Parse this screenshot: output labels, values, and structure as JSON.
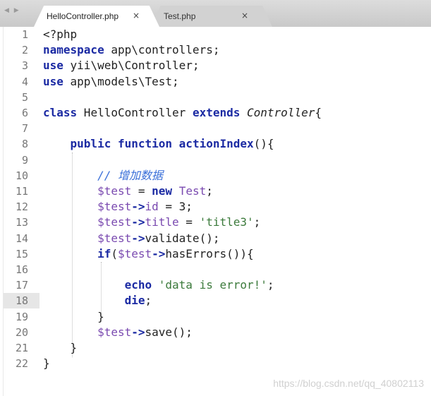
{
  "tabs": [
    {
      "label": "HelloController.php",
      "close": "×"
    },
    {
      "label": "Test.php",
      "close": "×"
    }
  ],
  "nav_arrows": "◀ ▶",
  "current_line": 18,
  "lines": [
    {
      "n": "1",
      "tokens": [
        {
          "t": "<?php",
          "c": "cls"
        }
      ]
    },
    {
      "n": "2",
      "tokens": [
        {
          "t": "namespace",
          "c": "kw"
        },
        {
          "t": " app\\controllers;",
          "c": "cls"
        }
      ]
    },
    {
      "n": "3",
      "tokens": [
        {
          "t": "use",
          "c": "kw"
        },
        {
          "t": " yii\\web\\Controller;",
          "c": "cls"
        }
      ]
    },
    {
      "n": "4",
      "tokens": [
        {
          "t": "use",
          "c": "kw"
        },
        {
          "t": " app\\models\\Test;",
          "c": "cls"
        }
      ]
    },
    {
      "n": "5",
      "tokens": []
    },
    {
      "n": "6",
      "tokens": [
        {
          "t": "class",
          "c": "kw"
        },
        {
          "t": " HelloController ",
          "c": "cls"
        },
        {
          "t": "extends",
          "c": "kw"
        },
        {
          "t": " ",
          "c": "cls"
        },
        {
          "t": "Controller",
          "c": "italic"
        },
        {
          "t": "{",
          "c": "cls"
        }
      ]
    },
    {
      "n": "7",
      "tokens": []
    },
    {
      "n": "8",
      "tokens": [
        {
          "t": "    ",
          "c": "cls"
        },
        {
          "t": "public",
          "c": "kw"
        },
        {
          "t": " ",
          "c": "cls"
        },
        {
          "t": "function",
          "c": "kw"
        },
        {
          "t": " ",
          "c": "cls"
        },
        {
          "t": "actionIndex",
          "c": "kw"
        },
        {
          "t": "(){",
          "c": "cls"
        }
      ]
    },
    {
      "n": "9",
      "tokens": []
    },
    {
      "n": "10",
      "tokens": [
        {
          "t": "        ",
          "c": "cls"
        },
        {
          "t": "// 增加数据",
          "c": "cmt"
        }
      ]
    },
    {
      "n": "11",
      "tokens": [
        {
          "t": "        ",
          "c": "cls"
        },
        {
          "t": "$test",
          "c": "var"
        },
        {
          "t": " = ",
          "c": "cls"
        },
        {
          "t": "new",
          "c": "kw"
        },
        {
          "t": " ",
          "c": "cls"
        },
        {
          "t": "Test",
          "c": "var"
        },
        {
          "t": ";",
          "c": "cls"
        }
      ]
    },
    {
      "n": "12",
      "tokens": [
        {
          "t": "        ",
          "c": "cls"
        },
        {
          "t": "$test",
          "c": "var"
        },
        {
          "t": "->",
          "c": "arrow"
        },
        {
          "t": "id",
          "c": "var"
        },
        {
          "t": " = 3;",
          "c": "cls"
        }
      ]
    },
    {
      "n": "13",
      "tokens": [
        {
          "t": "        ",
          "c": "cls"
        },
        {
          "t": "$test",
          "c": "var"
        },
        {
          "t": "->",
          "c": "arrow"
        },
        {
          "t": "title",
          "c": "var"
        },
        {
          "t": " = ",
          "c": "cls"
        },
        {
          "t": "'title3'",
          "c": "str"
        },
        {
          "t": ";",
          "c": "cls"
        }
      ]
    },
    {
      "n": "14",
      "tokens": [
        {
          "t": "        ",
          "c": "cls"
        },
        {
          "t": "$test",
          "c": "var"
        },
        {
          "t": "->",
          "c": "arrow"
        },
        {
          "t": "validate();",
          "c": "cls"
        }
      ]
    },
    {
      "n": "15",
      "tokens": [
        {
          "t": "        ",
          "c": "cls"
        },
        {
          "t": "if",
          "c": "kw"
        },
        {
          "t": "(",
          "c": "cls"
        },
        {
          "t": "$test",
          "c": "var"
        },
        {
          "t": "->",
          "c": "arrow"
        },
        {
          "t": "hasErrors()){",
          "c": "cls"
        }
      ]
    },
    {
      "n": "16",
      "tokens": []
    },
    {
      "n": "17",
      "tokens": [
        {
          "t": "            ",
          "c": "cls"
        },
        {
          "t": "echo",
          "c": "kw"
        },
        {
          "t": " ",
          "c": "cls"
        },
        {
          "t": "'data is error!'",
          "c": "str"
        },
        {
          "t": ";",
          "c": "cls"
        }
      ]
    },
    {
      "n": "18",
      "tokens": [
        {
          "t": "            ",
          "c": "cls"
        },
        {
          "t": "die",
          "c": "kw"
        },
        {
          "t": ";",
          "c": "cls"
        }
      ]
    },
    {
      "n": "19",
      "tokens": [
        {
          "t": "        }",
          "c": "cls"
        }
      ]
    },
    {
      "n": "20",
      "tokens": [
        {
          "t": "        ",
          "c": "cls"
        },
        {
          "t": "$test",
          "c": "var"
        },
        {
          "t": "->",
          "c": "arrow"
        },
        {
          "t": "save();",
          "c": "cls"
        }
      ]
    },
    {
      "n": "21",
      "tokens": [
        {
          "t": "    }",
          "c": "cls"
        }
      ]
    },
    {
      "n": "22",
      "tokens": [
        {
          "t": "}",
          "c": "cls"
        }
      ]
    }
  ],
  "watermark": "https://blog.csdn.net/qq_40802113"
}
